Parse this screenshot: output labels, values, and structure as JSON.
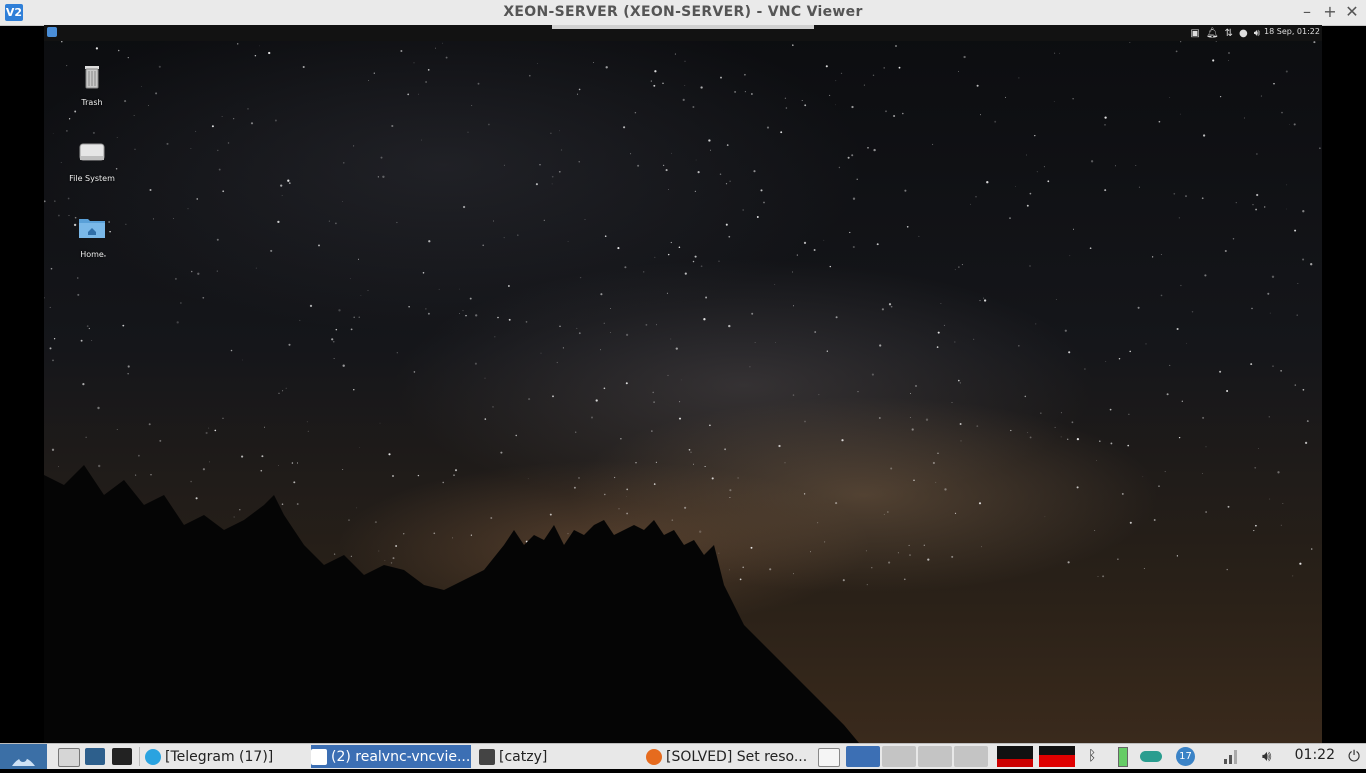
{
  "window": {
    "title": "XEON-SERVER (XEON-SERVER) - VNC Viewer",
    "app_icon": "V2",
    "controls": [
      "–",
      "+",
      "✕"
    ]
  },
  "remote_panel": {
    "date_time": "18 Sep, 01:22"
  },
  "desktop_icons": [
    {
      "label": "Trash",
      "icon": "trash-icon"
    },
    {
      "label": "File System",
      "icon": "drive-icon"
    },
    {
      "label": "Home",
      "icon": "home-folder-icon"
    }
  ],
  "taskbar": {
    "tasks": [
      {
        "label": "[Telegram (17)]",
        "icon": "telegram-icon"
      },
      {
        "label": "(2) realvnc-vncvie...",
        "icon": "vnc-icon"
      },
      {
        "label": "[catzy]",
        "icon": "folder-icon"
      },
      {
        "label": "[SOLVED] Set reso...",
        "icon": "firefox-icon"
      }
    ],
    "notification_count": "17",
    "clock": "01:22"
  },
  "colors": {
    "accent": "#3c6fb4",
    "taskbar_bg": "#e8e8e8",
    "titlebar_bg": "#eaeaea"
  }
}
